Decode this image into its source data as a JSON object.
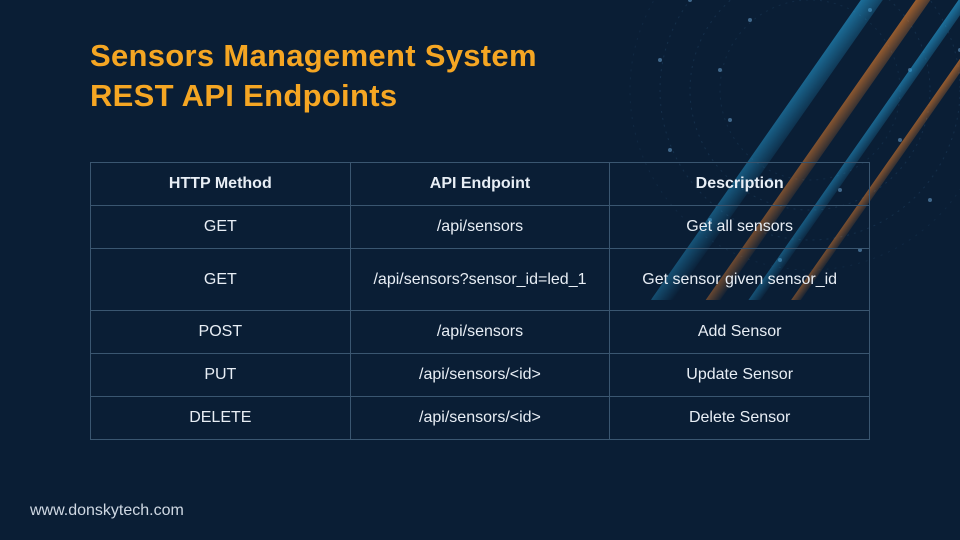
{
  "title_line1": "Sensors Management System",
  "title_line2": "REST API Endpoints",
  "table": {
    "headers": [
      "HTTP Method",
      "API Endpoint",
      "Description"
    ],
    "rows": [
      {
        "method": "GET",
        "endpoint": "/api/sensors",
        "description": "Get all sensors"
      },
      {
        "method": "GET",
        "endpoint": "/api/sensors?sensor_id=led_1",
        "description": "Get sensor given sensor_id"
      },
      {
        "method": "POST",
        "endpoint": "/api/sensors",
        "description": "Add Sensor"
      },
      {
        "method": "PUT",
        "endpoint": "/api/sensors/<id>",
        "description": "Update Sensor"
      },
      {
        "method": "DELETE",
        "endpoint": "/api/sensors/<id>",
        "description": "Delete Sensor"
      }
    ]
  },
  "footer": "www.donskytech.com"
}
